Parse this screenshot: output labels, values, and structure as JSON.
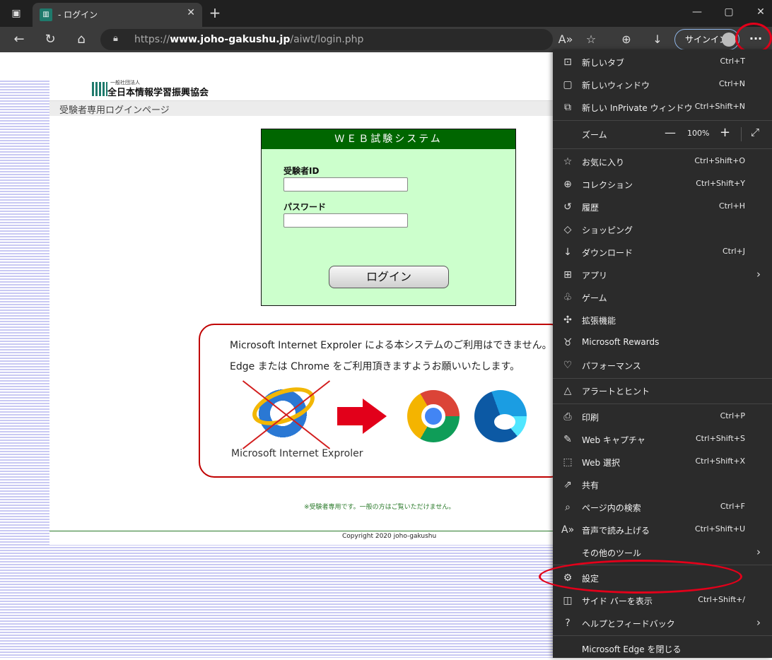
{
  "browser": {
    "tab_title": "- ログイン",
    "url_prefix": "https://",
    "url_host": "www.joho-gakushu.jp",
    "url_path": "/aiwt/login.php",
    "signin_label": "サインイン"
  },
  "page": {
    "org_small": "一般社団法人",
    "org_name": "全日本情報学習振興協会",
    "subheader": "受験者専用ログインページ",
    "login": {
      "title": "ＷＥＢ試験システム",
      "id_label": "受験者ID",
      "password_label": "パスワード",
      "button": "ログイン"
    },
    "notice": {
      "line1": "Microsoft Internet Exproler による本システムのご利用はできません。",
      "line2": "Edge または Chrome をご利用頂きますようお願いいたします。",
      "ie_caption": "Microsoft Internet Exproler"
    },
    "note": "※受験者専用です。一般の方はご覧いただけません。",
    "copyright": "Copyright 2020 joho-gakushu"
  },
  "menu": {
    "items": [
      {
        "label": "新しいタブ",
        "shortcut": "Ctrl+T",
        "icon": "new-tab-icon",
        "glyph": "⊡"
      },
      {
        "label": "新しいウィンドウ",
        "shortcut": "Ctrl+N",
        "icon": "new-window-icon",
        "glyph": "▢"
      },
      {
        "label": "新しい InPrivate ウィンドウ",
        "shortcut": "Ctrl+Shift+N",
        "icon": "inprivate-icon",
        "glyph": "⧉"
      },
      {
        "label": "お気に入り",
        "shortcut": "Ctrl+Shift+O",
        "icon": "favorites-icon",
        "glyph": "☆"
      },
      {
        "label": "コレクション",
        "shortcut": "Ctrl+Shift+Y",
        "icon": "collections-icon",
        "glyph": "⊕"
      },
      {
        "label": "履歴",
        "shortcut": "Ctrl+H",
        "icon": "history-icon",
        "glyph": "↺"
      },
      {
        "label": "ショッピング",
        "shortcut": "",
        "icon": "shopping-tag-icon",
        "glyph": "◇"
      },
      {
        "label": "ダウンロード",
        "shortcut": "Ctrl+J",
        "icon": "download-icon",
        "glyph": "↓"
      },
      {
        "label": "アプリ",
        "shortcut": "",
        "icon": "apps-icon",
        "glyph": "⊞",
        "submenu": true
      },
      {
        "label": "ゲーム",
        "shortcut": "",
        "icon": "games-icon",
        "glyph": "♧"
      },
      {
        "label": "拡張機能",
        "shortcut": "",
        "icon": "extensions-icon",
        "glyph": "✣"
      },
      {
        "label": "Microsoft Rewards",
        "shortcut": "",
        "icon": "rewards-icon",
        "glyph": "♉"
      },
      {
        "label": "パフォーマンス",
        "shortcut": "",
        "icon": "performance-icon",
        "glyph": "♡"
      },
      {
        "label": "アラートとヒント",
        "shortcut": "",
        "icon": "bell-icon",
        "glyph": "△"
      },
      {
        "label": "印刷",
        "shortcut": "Ctrl+P",
        "icon": "print-icon",
        "glyph": "⎙"
      },
      {
        "label": "Web キャプチャ",
        "shortcut": "Ctrl+Shift+S",
        "icon": "web-capture-icon",
        "glyph": "✎"
      },
      {
        "label": "Web 選択",
        "shortcut": "Ctrl+Shift+X",
        "icon": "web-select-icon",
        "glyph": "⬚"
      },
      {
        "label": "共有",
        "shortcut": "",
        "icon": "share-icon",
        "glyph": "⇗"
      },
      {
        "label": "ページ内の検索",
        "shortcut": "Ctrl+F",
        "icon": "find-icon",
        "glyph": "⌕"
      },
      {
        "label": "音声で読み上げる",
        "shortcut": "Ctrl+Shift+U",
        "icon": "read-aloud-icon",
        "glyph": "A»"
      },
      {
        "label": "その他のツール",
        "shortcut": "",
        "icon": "",
        "glyph": "",
        "submenu": true
      },
      {
        "label": "設定",
        "shortcut": "",
        "icon": "gear-icon",
        "glyph": "⚙"
      },
      {
        "label": "サイド バーを表示",
        "shortcut": "Ctrl+Shift+/",
        "icon": "sidebar-icon",
        "glyph": "◫"
      },
      {
        "label": "ヘルプとフィードバック",
        "shortcut": "",
        "icon": "help-icon",
        "glyph": "?",
        "submenu": true
      },
      {
        "label": "Microsoft Edge を閉じる",
        "shortcut": "",
        "icon": "",
        "glyph": ""
      }
    ],
    "zoom": {
      "label": "ズーム",
      "value": "100%"
    }
  },
  "colors": {
    "login_header": "#006600",
    "login_panel": "#ccffcc",
    "highlight": "#e2001a"
  }
}
